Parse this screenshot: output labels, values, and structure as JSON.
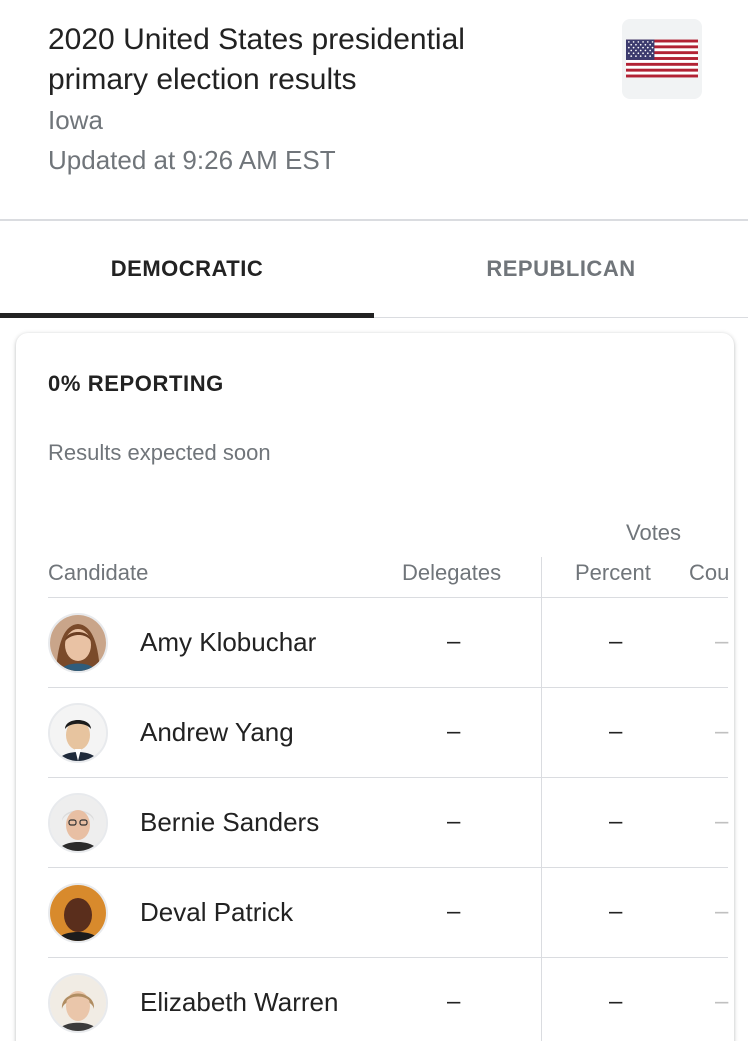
{
  "header": {
    "title": "2020 United States presidential primary election results",
    "state": "Iowa",
    "updated": "Updated at 9:26 AM EST",
    "flag_icon": "us-flag-icon"
  },
  "tabs": [
    {
      "label": "DEMOCRATIC",
      "selected": true
    },
    {
      "label": "REPUBLICAN",
      "selected": false
    }
  ],
  "results": {
    "reporting": "0% REPORTING",
    "status": "Results expected soon",
    "group_header": "Votes",
    "columns": {
      "candidate": "Candidate",
      "delegates": "Delegates",
      "percent": "Percent",
      "count": "Cou"
    },
    "candidates": [
      {
        "name": "Amy Klobuchar",
        "delegates": "–",
        "percent": "–",
        "count": "–"
      },
      {
        "name": "Andrew Yang",
        "delegates": "–",
        "percent": "–",
        "count": "–"
      },
      {
        "name": "Bernie Sanders",
        "delegates": "–",
        "percent": "–",
        "count": "–"
      },
      {
        "name": "Deval Patrick",
        "delegates": "–",
        "percent": "–",
        "count": "–"
      },
      {
        "name": "Elizabeth Warren",
        "delegates": "–",
        "percent": "–",
        "count": "–"
      }
    ]
  },
  "colors": {
    "text_primary": "#222222",
    "text_secondary": "#70757a",
    "divider": "#dadce0",
    "tab_indicator": "#222222"
  }
}
